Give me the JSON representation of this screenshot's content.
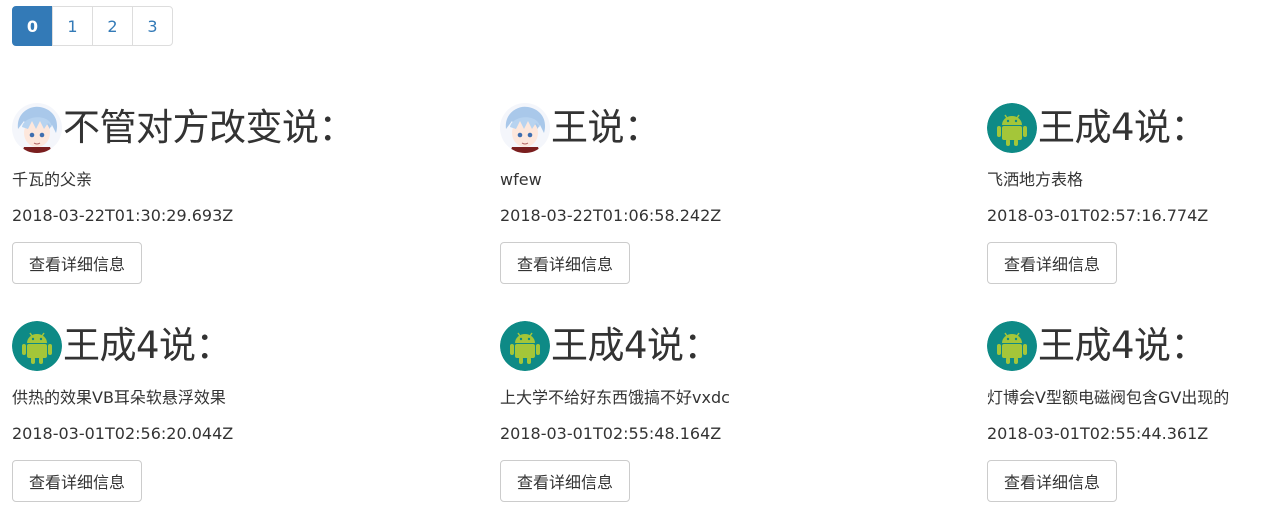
{
  "pagination": {
    "pages": [
      "0",
      "1",
      "2",
      "3"
    ],
    "active": "0"
  },
  "cards": [
    {
      "avatar": "anime-avatar-icon",
      "title": "不管对方改变说：",
      "content": "千瓦的父亲",
      "time": "2018-03-22T01:30:29.693Z",
      "button": "查看详细信息"
    },
    {
      "avatar": "anime-avatar-icon",
      "title": "王说：",
      "content": "wfew",
      "time": "2018-03-22T01:06:58.242Z",
      "button": "查看详细信息"
    },
    {
      "avatar": "android-icon",
      "title": "王成4说：",
      "content": "飞洒地方表格",
      "time": "2018-03-01T02:57:16.774Z",
      "button": "查看详细信息"
    },
    {
      "avatar": "android-icon",
      "title": "王成4说：",
      "content": "供热的效果VB耳朵软悬浮效果",
      "time": "2018-03-01T02:56:20.044Z",
      "button": "查看详细信息"
    },
    {
      "avatar": "android-icon",
      "title": "王成4说：",
      "content": "上大学不给好东西饿搞不好vxdc",
      "time": "2018-03-01T02:55:48.164Z",
      "button": "查看详细信息"
    },
    {
      "avatar": "android-icon",
      "title": "王成4说：",
      "content": "灯博会V型额电磁阀包含GV出现的",
      "time": "2018-03-01T02:55:44.361Z",
      "button": "查看详细信息"
    }
  ],
  "colors": {
    "primary": "#337ab7",
    "android_bg": "#0e8a86",
    "android_green": "#a4c639"
  }
}
